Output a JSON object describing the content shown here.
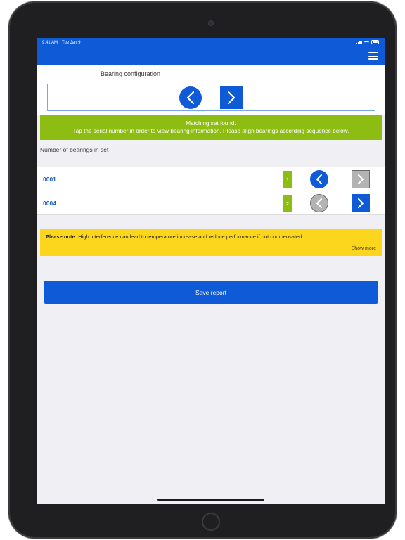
{
  "status_bar": {
    "time": "9:41 AM",
    "date": "Tue Jan 9"
  },
  "header": {
    "menu_icon": "hamburger-menu-icon",
    "color": "#0f5ad6"
  },
  "configuration": {
    "title": "Bearing configuration",
    "prev_icon": "chevron-left-icon",
    "next_icon": "chevron-right-icon"
  },
  "match_banner": {
    "line1": "Matching set found.",
    "line2": "Tap the serial number in order to view bearing information. Please align bearings according sequence below.",
    "color": "#8dbd12"
  },
  "bearings": {
    "label": "Number of bearings in set",
    "rows": [
      {
        "serial": "0001",
        "sequence": "1",
        "prev_enabled": true,
        "next_enabled": false
      },
      {
        "serial": "0004",
        "sequence": "2",
        "prev_enabled": false,
        "next_enabled": true
      }
    ]
  },
  "note": {
    "prefix": "Please note:",
    "text": " High interference can lead to temperature increase and reduce performance if not compensated",
    "show_more": "Show more",
    "color": "#fbd61c"
  },
  "actions": {
    "save_label": "Save report"
  }
}
